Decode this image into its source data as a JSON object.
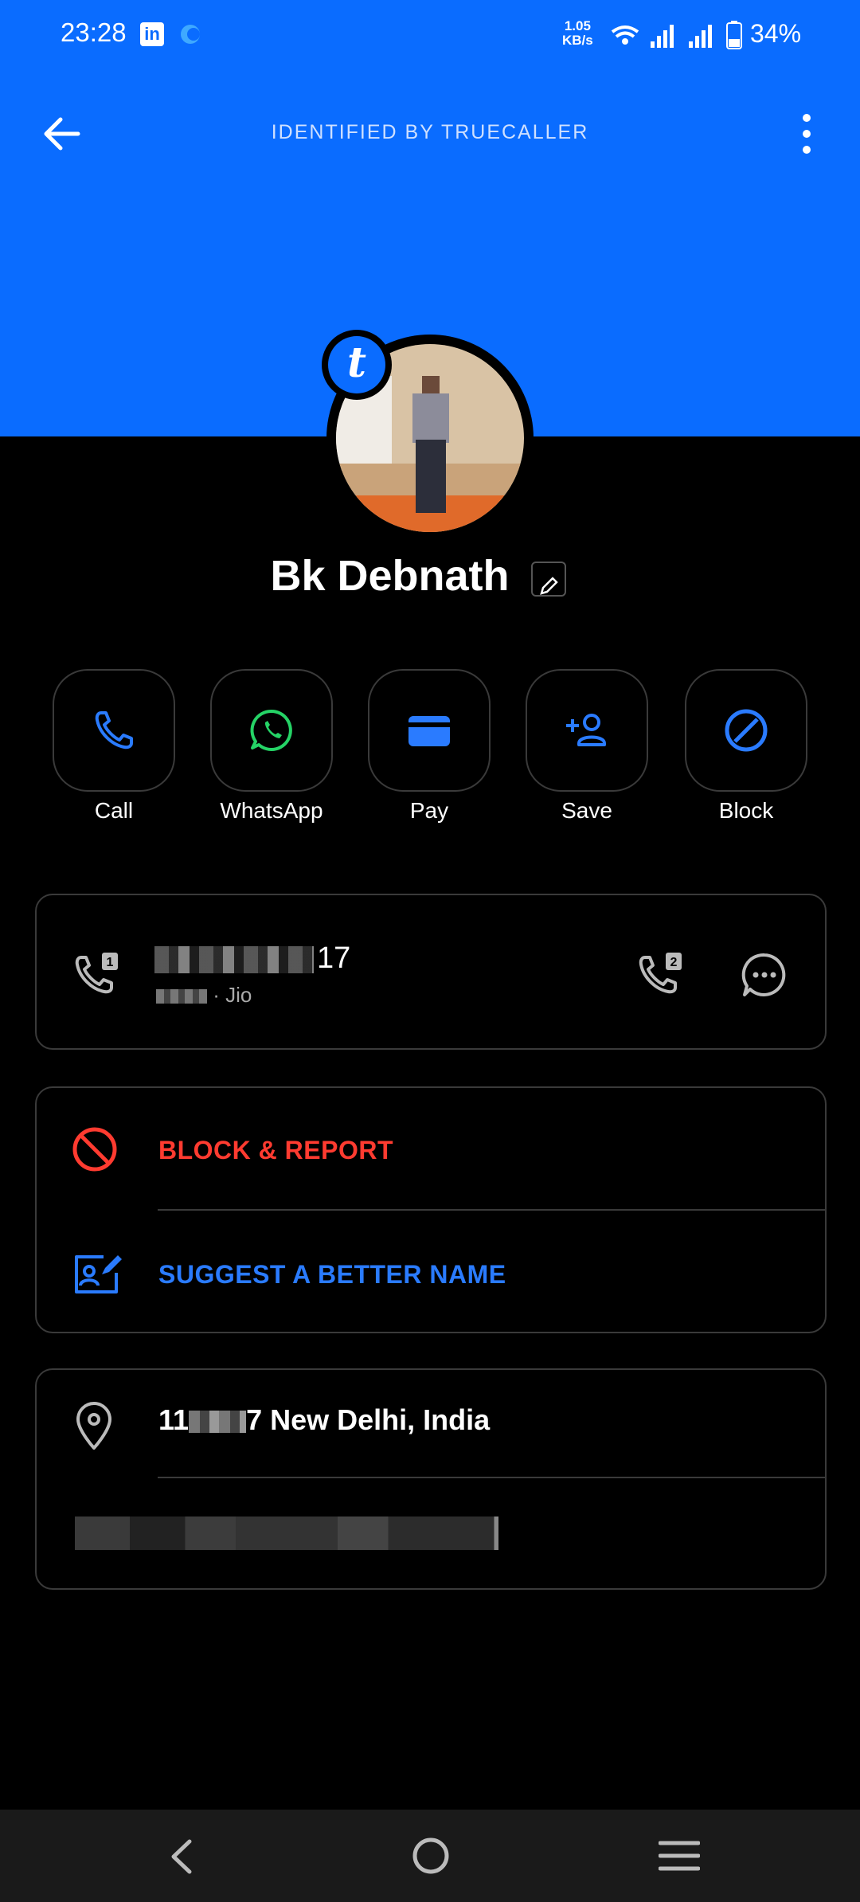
{
  "status_bar": {
    "time": "23:28",
    "net_speed_value": "1.05",
    "net_speed_unit": "KB/s",
    "battery": "34%"
  },
  "app_bar": {
    "title": "IDENTIFIED BY TRUECALLER"
  },
  "badge": {
    "letter": "t"
  },
  "contact": {
    "name": "Bk Debnath"
  },
  "actions": [
    {
      "label": "Call",
      "icon": "phone-icon"
    },
    {
      "label": "WhatsApp",
      "icon": "whatsapp-icon"
    },
    {
      "label": "Pay",
      "icon": "wallet-icon"
    },
    {
      "label": "Save",
      "icon": "add-contact-icon"
    },
    {
      "label": "Block",
      "icon": "block-icon"
    }
  ],
  "number_card": {
    "number_visible_suffix": "17",
    "carrier": "· Jio"
  },
  "block_row": {
    "label": "BLOCK & REPORT"
  },
  "suggest_row": {
    "label": "SUGGEST A BETTER NAME"
  },
  "address": {
    "prefix": "11",
    "suffix": "7 New Delhi, India"
  },
  "colors": {
    "header_blue": "#0a6cff",
    "accent_blue": "#2a7bff",
    "danger_red": "#ff3b30",
    "whatsapp_green": "#25d366"
  }
}
